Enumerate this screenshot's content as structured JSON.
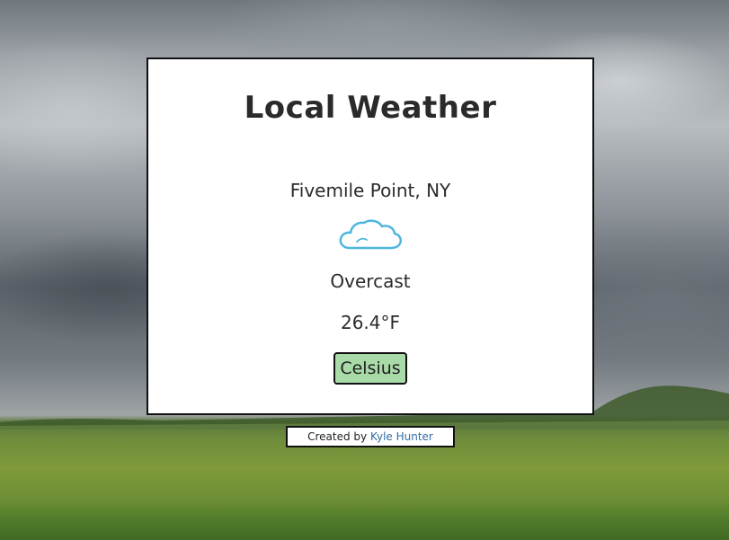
{
  "weather": {
    "title": "Local Weather",
    "location": "Fivemile Point, NY",
    "icon": "cloud-icon",
    "condition": "Overcast",
    "temperature": "26.4°F",
    "toggle_label": "Celsius",
    "toggle_color": "#a9dba8"
  },
  "footer": {
    "prefix": "Created by ",
    "author": "Kyle Hunter",
    "link_color": "#2e6da4"
  }
}
